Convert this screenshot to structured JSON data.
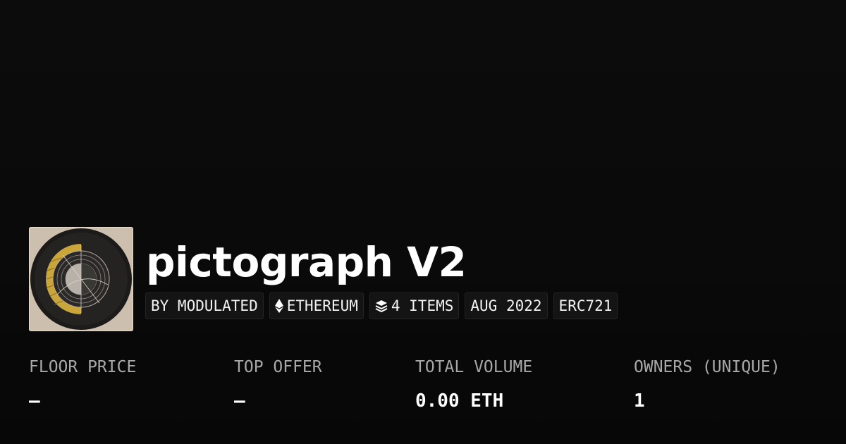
{
  "collection": {
    "title": "pictograph V2",
    "thumbnail_icon": "collection-thumbnail-artwork",
    "tags": {
      "creator": "BY MODULATED",
      "chain": "ETHEREUM",
      "chain_icon": "ethereum-icon",
      "items": "4 ITEMS",
      "items_icon": "layers-icon",
      "date": "AUG 2022",
      "standard": "ERC721"
    }
  },
  "stats": {
    "floor_price": {
      "label": "FLOOR PRICE",
      "value": "—"
    },
    "top_offer": {
      "label": "TOP OFFER",
      "value": "—"
    },
    "total_volume": {
      "label": "TOTAL VOLUME",
      "value": "0.00 ETH"
    },
    "owners": {
      "label": "OWNERS (UNIQUE)",
      "value": "1"
    }
  },
  "colors": {
    "background": "#0a0a0a",
    "text": "#ffffff",
    "muted": "#a8a8a8",
    "tag_bg": "#141414",
    "tag_border": "#242424",
    "art_gold": "#c9a53a",
    "art_paper": "#cfc3b4"
  }
}
